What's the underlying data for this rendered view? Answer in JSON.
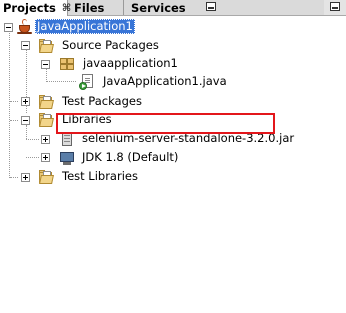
{
  "tabs": [
    {
      "label": "Projects",
      "active": true,
      "closable": true,
      "close_glyph": "⌘"
    },
    {
      "label": "Files",
      "active": false
    },
    {
      "label": "Services",
      "active": false
    }
  ],
  "tree": {
    "project": {
      "label": "JavaApplication1",
      "icon": "java-project-icon",
      "selected": true
    },
    "source_packages": {
      "label": "Source Packages",
      "icon": "source-folder-icon"
    },
    "package": {
      "label": "javaapplication1",
      "icon": "package-icon"
    },
    "main_file": {
      "label": "JavaApplication1.java",
      "icon": "java-main-file-icon"
    },
    "test_packages": {
      "label": "Test Packages",
      "icon": "test-folder-icon"
    },
    "libraries": {
      "label": "Libraries",
      "icon": "library-folder-icon"
    },
    "selenium_jar": {
      "label": "selenium-server-standalone-3.2.0.jar",
      "icon": "jar-icon",
      "highlighted": true
    },
    "jdk": {
      "label": "JDK 1.8 (Default)",
      "icon": "jdk-icon"
    },
    "test_libraries": {
      "label": "Test Libraries",
      "icon": "test-library-folder-icon"
    }
  },
  "colors": {
    "selection": "#3875d7",
    "highlight_box": "#e3161b"
  }
}
